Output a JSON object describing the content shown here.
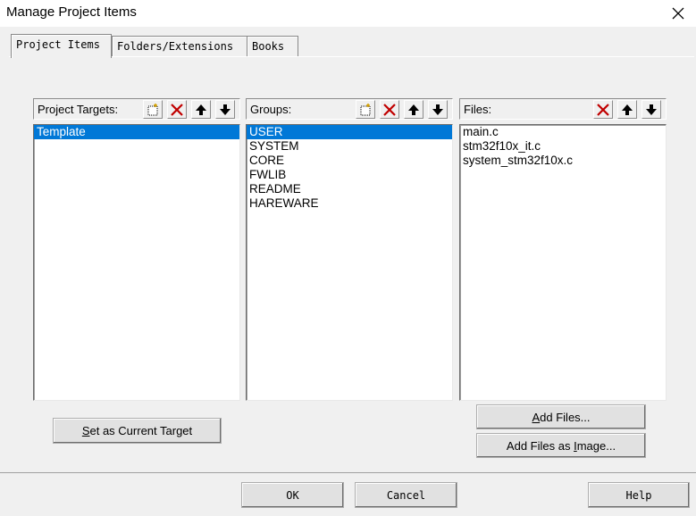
{
  "window": {
    "title": "Manage Project Items"
  },
  "tabs": [
    {
      "label": "Project Items",
      "active": true
    },
    {
      "label": "Folders/Extensions",
      "active": false
    },
    {
      "label": "Books",
      "active": false
    }
  ],
  "targets": {
    "label": "Project Targets:",
    "items": [
      "Template"
    ],
    "selected_index": 0
  },
  "groups": {
    "label": "Groups:",
    "items": [
      "USER",
      "SYSTEM",
      "CORE",
      "FWLIB",
      "README",
      "HAREWARE"
    ],
    "selected_index": 0
  },
  "files": {
    "label": "Files:",
    "items": [
      "main.c",
      "stm32f10x_it.c",
      "system_stm32f10x.c"
    ]
  },
  "buttons": {
    "set_current_target": {
      "mnemonic": "S",
      "rest": "et as Current Target"
    },
    "add_files": {
      "mnemonic": "A",
      "rest": "dd Files..."
    },
    "add_files_image": {
      "pre": "Add Files as ",
      "mnemonic": "I",
      "rest": "mage..."
    },
    "ok": "OK",
    "cancel": "Cancel",
    "help": "Help"
  },
  "colors": {
    "selection": "#0078d7",
    "delete_icon": "#c00000"
  }
}
